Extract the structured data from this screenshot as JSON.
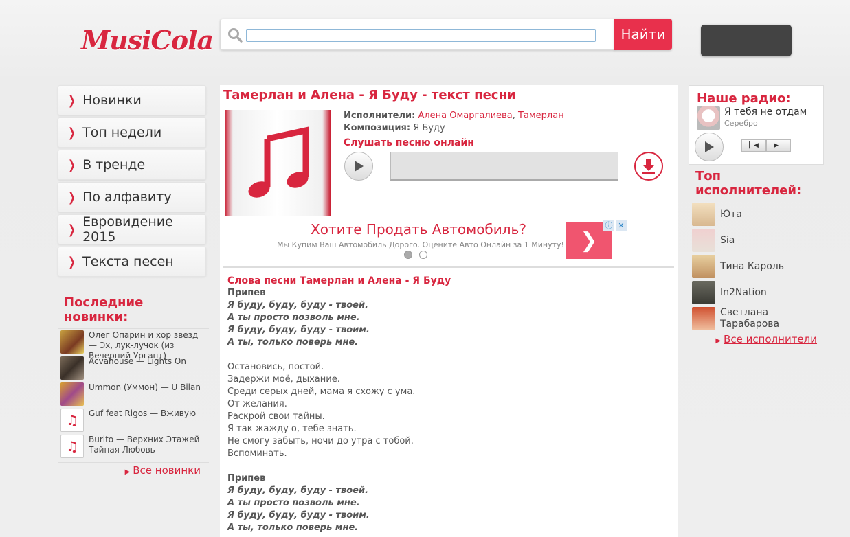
{
  "header": {
    "logo": "MusiCola",
    "search_placeholder": "",
    "search_button": "Найти"
  },
  "menu": [
    {
      "label": "Новинки"
    },
    {
      "label": "Топ недели"
    },
    {
      "label": "В тренде"
    },
    {
      "label": "По алфавиту"
    },
    {
      "label": "Евровидение 2015"
    },
    {
      "label": "Текста песен"
    }
  ],
  "latest": {
    "title": "Последние новинки:",
    "items": [
      {
        "text": "Олег Опарин и хор звезд — Эх, лук-лучок (из Вечерний Ургант)",
        "thumb": "photo"
      },
      {
        "text": "Acvahouse — Lights On",
        "thumb": "photo"
      },
      {
        "text": "Ummon (Уммон) — U Bilan",
        "thumb": "photo"
      },
      {
        "text": "Guf feat Rigos — Вживую",
        "thumb": "note"
      },
      {
        "text": "Burito — Верхних Этажей Тайная Любовь",
        "thumb": "note"
      }
    ],
    "more": "Все новинки"
  },
  "song": {
    "title": "Тамерлан и Алена - Я Буду - текст песни",
    "artists_label": "Исполнители:",
    "artist1": "Алена Омаргалиева",
    "artist_sep": ",",
    "artist2": "Тамерлан",
    "composition_label": "Композиция:",
    "composition": "Я Буду",
    "listen": "Слушать песню онлайн"
  },
  "ad": {
    "title": "Хотите Продать Автомобиль?",
    "subtitle": "Мы Купим Ваш Автомобиль Дорого. Оцените Авто Онлайн за 1 Минуту!",
    "arrow": "❯",
    "info_icon": "ⓘ",
    "close_icon": "✕"
  },
  "lyrics": {
    "title": "Слова песни Тамерлан и Алена - Я Буду",
    "chorus_label": "Припев",
    "chorus": [
      "Я буду, буду, буду - твоей.",
      "А ты просто позволь мне.",
      "Я буду, буду, буду - твоим.",
      "А ты, только поверь мне."
    ],
    "verse": [
      "Остановись, постой.",
      "Задержи моё, дыхание.",
      "Среди серых дней, мама я схожу с ума.",
      "От желания.",
      "Раскрой свои тайны.",
      "Я так жажду о, тебе знать.",
      "Не смогу забыть, ночи до утра с тобой.",
      "Вспоминать."
    ]
  },
  "radio": {
    "title": "Наше радио:",
    "song": "Я тебя не отдам",
    "artist": "Серебро"
  },
  "top_artists": {
    "title": "Топ исполнителей:",
    "items": [
      {
        "name": "Юта"
      },
      {
        "name": "Sia"
      },
      {
        "name": "Тина Кароль"
      },
      {
        "name": "In2Nation"
      },
      {
        "name": "Светлана Тарабарова"
      }
    ],
    "more": "Все исполнители"
  },
  "colors": {
    "accent": "#d8263f",
    "button": "#e8304c"
  }
}
